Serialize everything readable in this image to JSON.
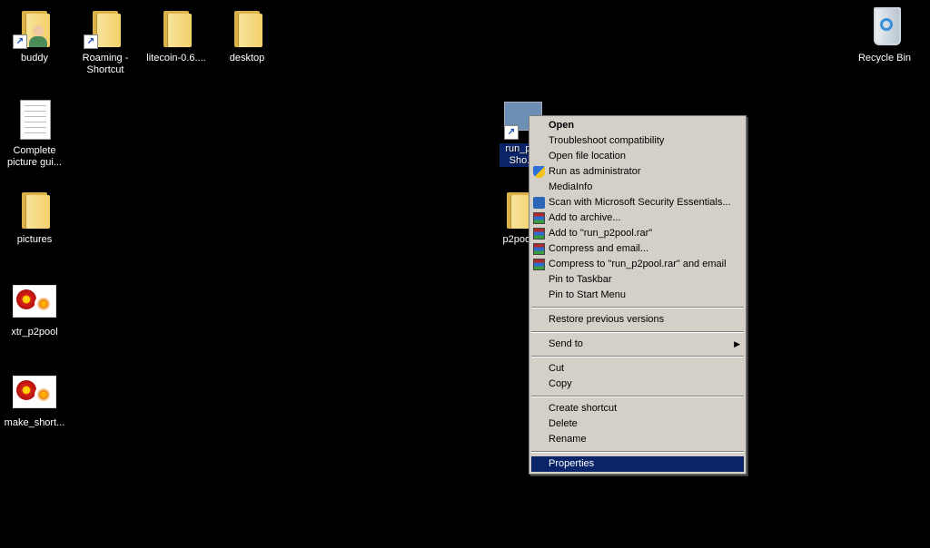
{
  "desktop": {
    "icons": [
      {
        "label": "buddy"
      },
      {
        "label": "Roaming - Shortcut"
      },
      {
        "label": "litecoin-0.6...."
      },
      {
        "label": "desktop"
      },
      {
        "label": "Complete picture gui..."
      },
      {
        "label": "pictures"
      },
      {
        "label": "xtr_p2pool"
      },
      {
        "label": "make_short..."
      },
      {
        "label": "run_p... Sho..."
      },
      {
        "label": "p2pool"
      },
      {
        "label": "Recycle Bin"
      }
    ]
  },
  "context_menu": {
    "items": {
      "open": "Open",
      "troubleshoot": "Troubleshoot compatibility",
      "open_location": "Open file location",
      "run_admin": "Run as administrator",
      "mediainfo": "MediaInfo",
      "scan": "Scan with Microsoft Security Essentials...",
      "add_archive": "Add to archive...",
      "add_rar": "Add to \"run_p2pool.rar\"",
      "compress_email": "Compress and email...",
      "compress_rar_email": "Compress to \"run_p2pool.rar\" and email",
      "pin_taskbar": "Pin to Taskbar",
      "pin_start": "Pin to Start Menu",
      "restore": "Restore previous versions",
      "send_to": "Send to",
      "cut": "Cut",
      "copy": "Copy",
      "create_shortcut": "Create shortcut",
      "delete": "Delete",
      "rename": "Rename",
      "properties": "Properties"
    },
    "submenu_arrow": "▶",
    "highlight_color": "#0a246a"
  }
}
